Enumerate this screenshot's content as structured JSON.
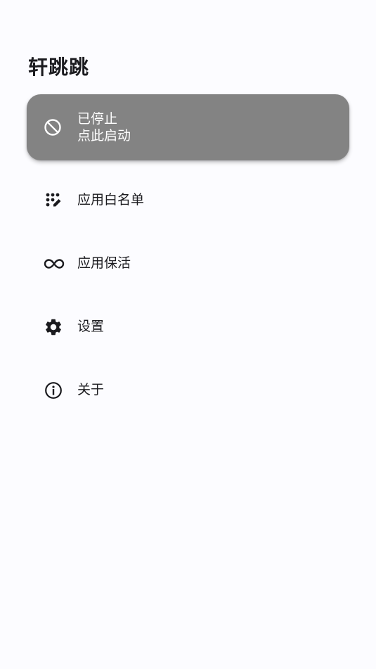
{
  "app": {
    "title": "轩跳跳"
  },
  "status": {
    "line1": "已停止",
    "line2": "点此启动",
    "icon": "block-icon",
    "card_color": "#838383"
  },
  "menu": {
    "items": [
      {
        "label": "应用白名单",
        "icon": "app-registration-icon"
      },
      {
        "label": "应用保活",
        "icon": "infinity-icon"
      },
      {
        "label": "设置",
        "icon": "gear-icon"
      },
      {
        "label": "关于",
        "icon": "info-icon"
      }
    ]
  }
}
